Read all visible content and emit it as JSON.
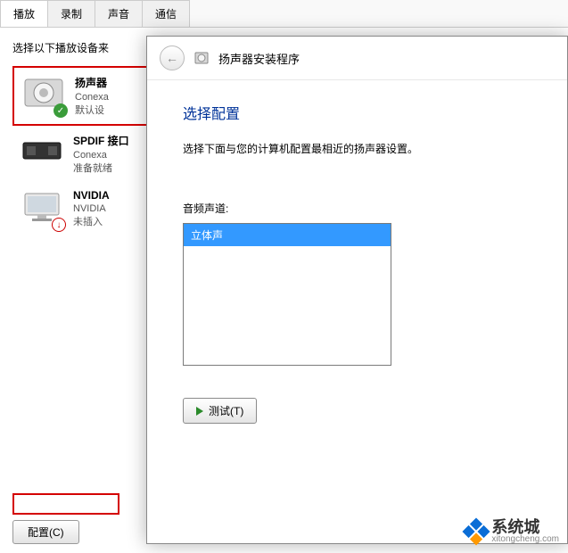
{
  "tabs": {
    "playback": "播放",
    "recording": "录制",
    "sounds": "声音",
    "communications": "通信"
  },
  "instruction": "选择以下播放设备来",
  "devices": [
    {
      "title": "扬声器",
      "subtitle": "Conexa",
      "status": "默认设"
    },
    {
      "title": "SPDIF 接口",
      "subtitle": "Conexa",
      "status": "准备就绪"
    },
    {
      "title": "NVIDIA",
      "subtitle": "NVIDIA",
      "status": "未插入"
    }
  ],
  "configure_button": "配置(C)",
  "wizard": {
    "title": "扬声器安装程序",
    "heading": "选择配置",
    "description": "选择下面与您的计算机配置最相近的扬声器设置。",
    "audio_channel_label": "音频声道:",
    "options": {
      "stereo": "立体声"
    },
    "test_button": "测试(T)"
  },
  "watermark": {
    "brand": "系统城",
    "url": "xitongcheng.com"
  }
}
